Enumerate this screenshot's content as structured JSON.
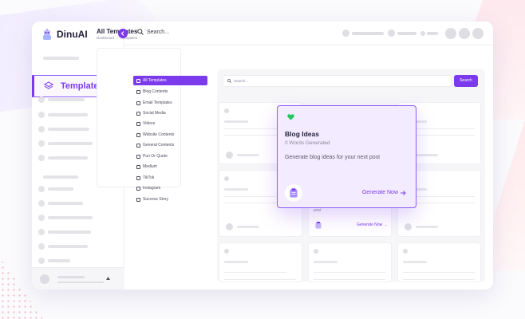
{
  "brand": {
    "name": "DinuAI",
    "accent": "#7c3aed"
  },
  "sidebar": {
    "active_item": {
      "label": "Templates",
      "icon": "layers-icon"
    },
    "collapse_icon": "chevron-left-icon"
  },
  "topbar": {
    "search_placeholder": "Search..."
  },
  "page": {
    "title": "All Templates",
    "breadcrumb": [
      "Dashboard",
      "Templates"
    ],
    "breadcrumb_sep": ">"
  },
  "categories": [
    {
      "label": "All Templates",
      "icon": "grid-icon",
      "active": true
    },
    {
      "label": "Blog Contents",
      "icon": "book-icon",
      "active": false
    },
    {
      "label": "Email Templates",
      "icon": "mail-icon",
      "active": false
    },
    {
      "label": "Social Media",
      "icon": "share-icon",
      "active": false
    },
    {
      "label": "Videos",
      "icon": "video-icon",
      "active": false
    },
    {
      "label": "Website Contents",
      "icon": "monitor-icon",
      "active": false
    },
    {
      "label": "General Contents",
      "icon": "document-icon",
      "active": false
    },
    {
      "label": "Pun Or Quote",
      "icon": "quote-icon",
      "active": false
    },
    {
      "label": "Medium",
      "icon": "medium-icon",
      "active": false
    },
    {
      "label": "TikTok",
      "icon": "tiktok-icon",
      "active": false
    },
    {
      "label": "Instagram",
      "icon": "instagram-icon",
      "active": false
    },
    {
      "label": "Success Story",
      "icon": "star-icon",
      "active": false
    }
  ],
  "template_search": {
    "placeholder": "Search...",
    "button_label": "Search"
  },
  "featured_card": {
    "title": "Blog Ideas",
    "words_generated": "0 Words Generated",
    "description": "Generate blog ideas for your next post",
    "cta": "Generate Now",
    "favorite_color": "#22c55e"
  },
  "partial_card": {
    "fragment_text": "post",
    "cta": "Generate Now"
  }
}
